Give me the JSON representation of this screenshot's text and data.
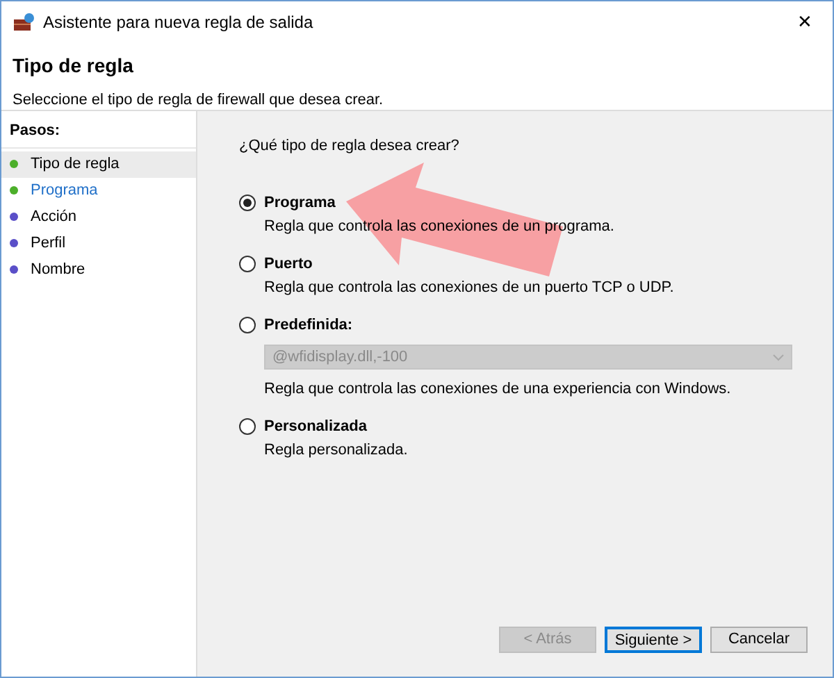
{
  "window": {
    "title": "Asistente para nueva regla de salida",
    "close": "✕"
  },
  "header": {
    "title": "Tipo de regla",
    "subtitle": "Seleccione el tipo de regla de firewall que desea crear."
  },
  "steps": {
    "title": "Pasos:",
    "items": [
      {
        "label": "Tipo de regla",
        "selected": true,
        "current": false,
        "color": "#4caf2a"
      },
      {
        "label": "Programa",
        "selected": false,
        "current": true,
        "color": "#4caf2a"
      },
      {
        "label": "Acción",
        "selected": false,
        "current": false,
        "color": "#5a4fc8"
      },
      {
        "label": "Perfil",
        "selected": false,
        "current": false,
        "color": "#5a4fc8"
      },
      {
        "label": "Nombre",
        "selected": false,
        "current": false,
        "color": "#5a4fc8"
      }
    ]
  },
  "question": "¿Qué tipo de regla desea crear?",
  "options": [
    {
      "label": "Programa",
      "description": "Regla que controla las conexiones de un programa.",
      "selected": true
    },
    {
      "label": "Puerto",
      "description": "Regla que controla las conexiones de un puerto TCP o UDP.",
      "selected": false
    },
    {
      "label": "Predefinida:",
      "description": "Regla que controla las conexiones de una experiencia con Windows.",
      "selected": false,
      "dropdown": {
        "value": "@wfidisplay.dll,-100",
        "disabled": true
      }
    },
    {
      "label": "Personalizada",
      "description": "Regla personalizada.",
      "selected": false
    }
  ],
  "buttons": [
    {
      "label": "< Atrás",
      "disabled": true,
      "default": false
    },
    {
      "label": "Siguiente >",
      "disabled": false,
      "default": true
    },
    {
      "label": "Cancelar",
      "disabled": false,
      "default": false
    }
  ]
}
